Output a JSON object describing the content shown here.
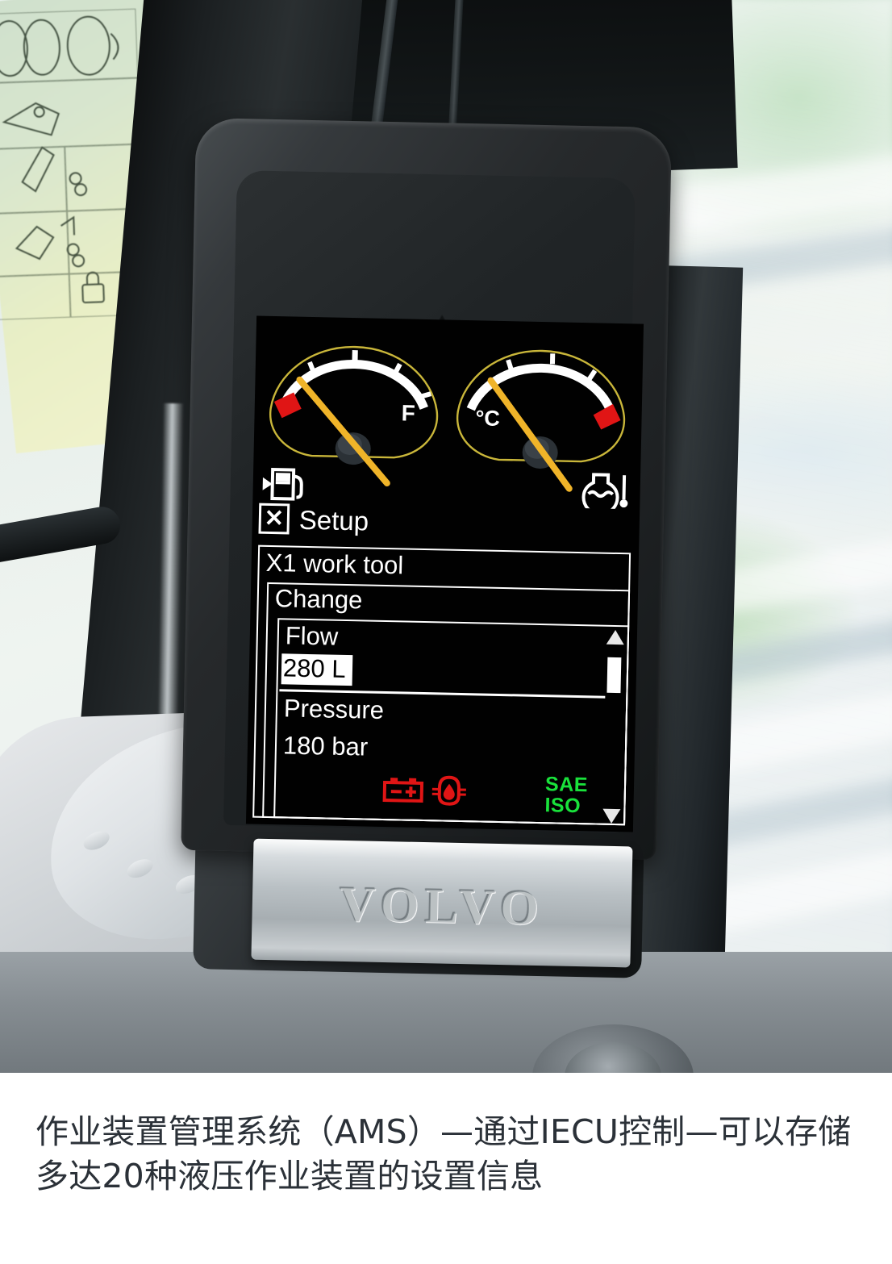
{
  "caption": {
    "text": "作业装置管理系统（AMS）—通过IECU控制—可以存储多达20种液压作业装置的设置信息"
  },
  "device": {
    "brand": "VOLVO",
    "brand_plate_material": "silver",
    "sensor_notch_icon": "triangle-notch-icon"
  },
  "display": {
    "background_color": "#010101",
    "text_color": "#ffffff",
    "gauges": [
      {
        "id": "fuel",
        "icon_name": "fuel-pump-icon",
        "scale_label": "F",
        "warning_zone": "left",
        "warning_color": "#e01515",
        "needle_color": "#f0b429",
        "arc_color": "#ffffff",
        "outline_color": "#c8b336",
        "tick_count": 5,
        "needle_value_pct": 8
      },
      {
        "id": "coolant-temperature",
        "icon_name": "coolant-temperature-icon",
        "scale_label": "°C",
        "warning_zone": "right",
        "warning_color": "#e01515",
        "needle_color": "#f0b429",
        "arc_color": "#ffffff",
        "outline_color": "#c8b336",
        "tick_count": 4,
        "needle_value_pct": 12
      }
    ],
    "header": {
      "icon_glyph": "✕",
      "icon_name": "x-work-tool-icon",
      "label": "Setup"
    },
    "menu": {
      "tool_title": "X1 work tool",
      "section": "Change",
      "items": [
        {
          "label": "Flow",
          "value": "280 L",
          "selected": true
        },
        {
          "label": "Pressure",
          "value": "180 bar",
          "selected": false
        }
      ],
      "scrollbar": {
        "up_arrow": "scroll-up-arrow-icon",
        "down_arrow": "scroll-down-arrow-icon",
        "thumb_position_pct": 14
      }
    },
    "status_bar": {
      "indicators": [
        {
          "name": "battery-charge-icon",
          "color": "#e01515"
        },
        {
          "name": "engine-oil-pressure-icon",
          "color": "#e01515"
        }
      ],
      "standard_line1": "SAE",
      "standard_line2": "ISO",
      "standard_color": "#19e23b"
    }
  }
}
